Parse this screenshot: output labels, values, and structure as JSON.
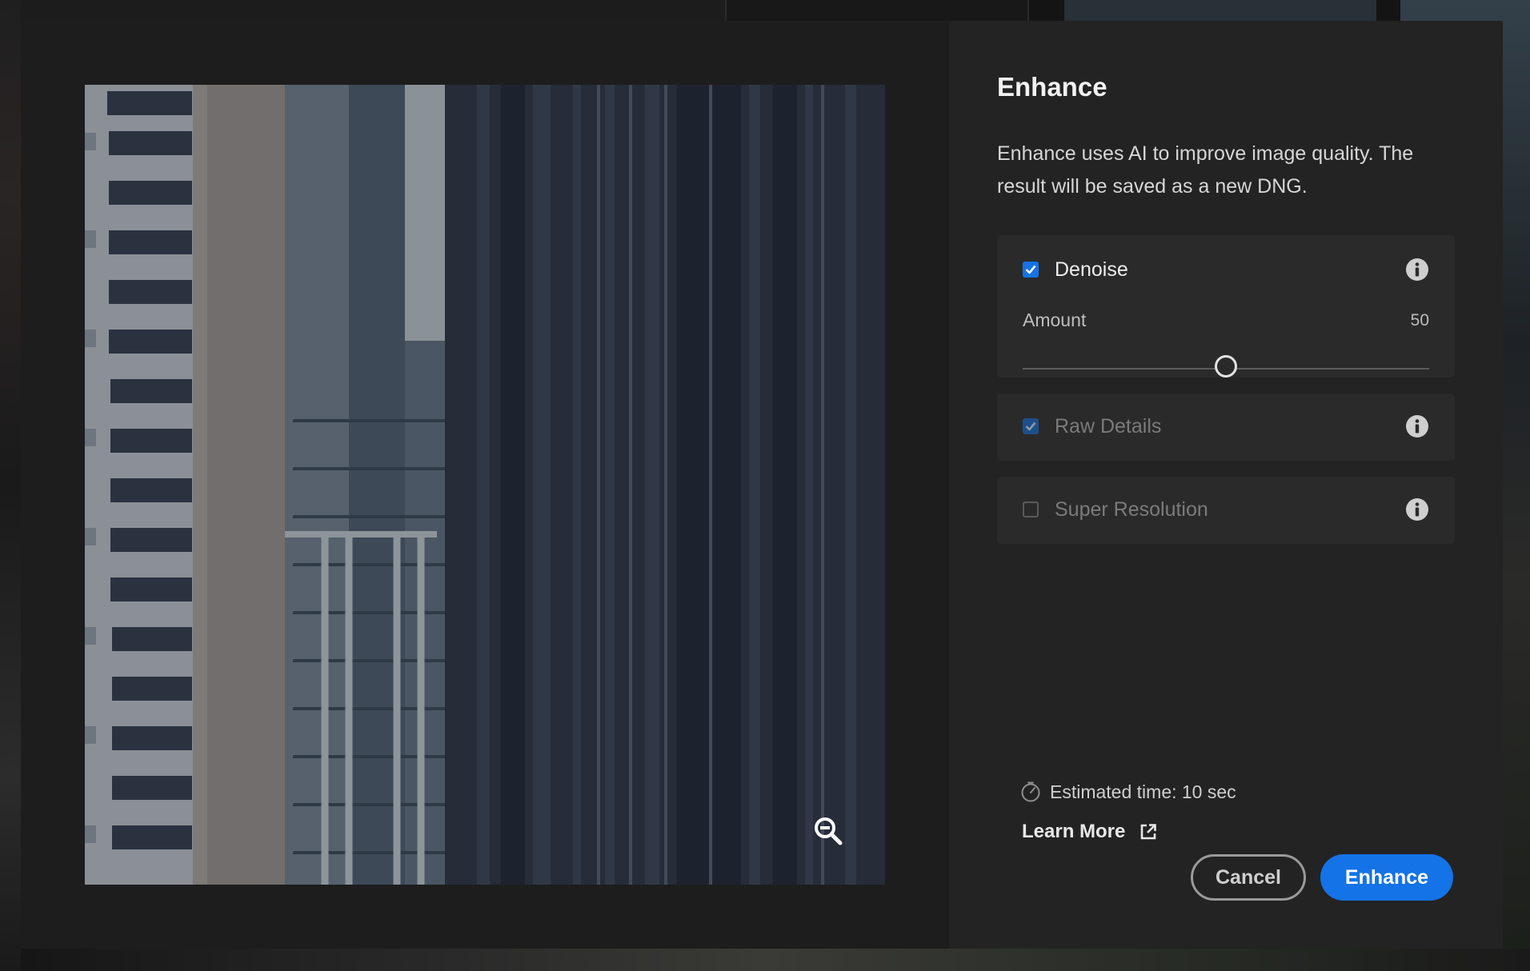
{
  "dialog": {
    "title": "Enhance",
    "description": "Enhance uses AI to improve image quality. The result will be saved as a new DNG."
  },
  "options": {
    "denoise": {
      "label": "Denoise",
      "checked": true,
      "enabled": true
    },
    "raw_details": {
      "label": "Raw Details",
      "checked": true,
      "enabled": false
    },
    "super_resolution": {
      "label": "Super Resolution",
      "checked": false,
      "enabled": false
    }
  },
  "amount": {
    "label": "Amount",
    "value": "50",
    "min": 0,
    "max": 100
  },
  "estimate": {
    "text": "Estimated time: 10 sec"
  },
  "links": {
    "learn_more": "Learn More"
  },
  "buttons": {
    "cancel": "Cancel",
    "enhance": "Enhance"
  },
  "icons": {
    "zoom": "zoom-out-icon",
    "info": "info-icon",
    "timer": "stopwatch-icon",
    "external": "external-link-icon"
  },
  "colors": {
    "accent": "#1473e6",
    "panel_bg": "#232323",
    "card_bg": "#2a2a2a"
  }
}
